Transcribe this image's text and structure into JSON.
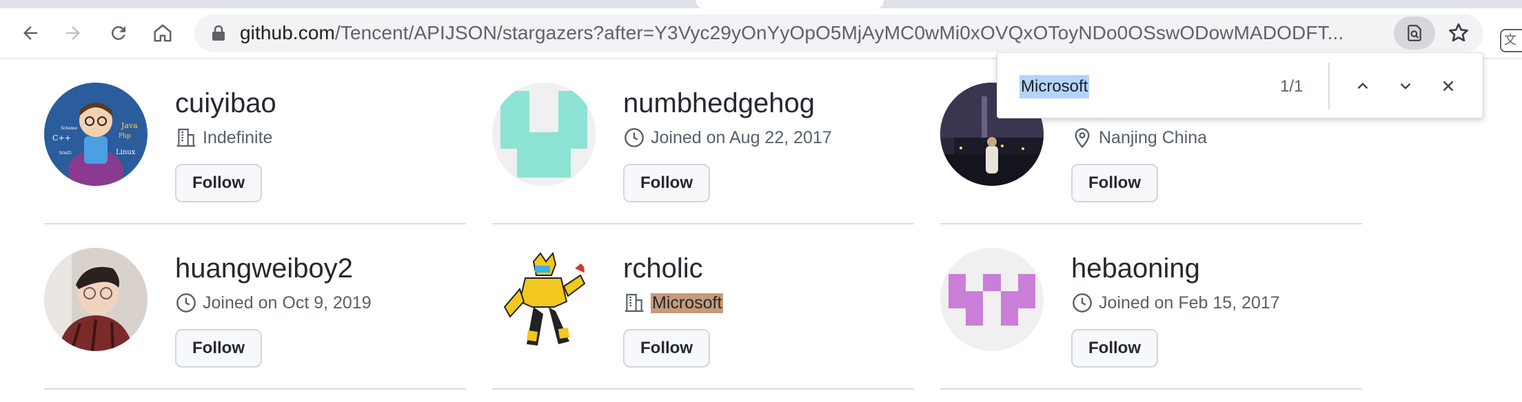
{
  "browser": {
    "url_host": "github.com",
    "url_path": "/Tencent/APIJSON/stargazers?after=Y3Vyc29yOnYyOpO5MjAyMC0wMi0xOVQxOToyNDo0OSswODowMADODFT...",
    "ext_glyph": "文"
  },
  "findbar": {
    "query": "Microsoft",
    "count": "1/1"
  },
  "users": [
    {
      "name": "cuiyibao",
      "meta_icon": "building-icon",
      "meta": "Indefinite",
      "highlight": false,
      "follow": "Follow"
    },
    {
      "name": "numbhedgehog",
      "meta_icon": "clock-icon",
      "meta": "Joined on Aug 22, 2017",
      "highlight": false,
      "follow": "Follow"
    },
    {
      "name": "",
      "meta_icon": "location-icon",
      "meta": "Nanjing China",
      "highlight": false,
      "follow": "Follow"
    },
    {
      "name": "huangweiboy2",
      "meta_icon": "clock-icon",
      "meta": "Joined on Oct 9, 2019",
      "highlight": false,
      "follow": "Follow"
    },
    {
      "name": "rcholic",
      "meta_icon": "building-icon",
      "meta": "Microsoft",
      "highlight": true,
      "follow": "Follow"
    },
    {
      "name": "hebaoning",
      "meta_icon": "clock-icon",
      "meta": "Joined on Feb 15, 2017",
      "highlight": false,
      "follow": "Follow"
    }
  ],
  "avatar_text": {
    "lang1": "Java",
    "lang2": "Php",
    "lang3": "C++",
    "lang4": "Linux",
    "lang5": "Scheme",
    "lang6": "html5"
  },
  "colors": {
    "identicon_teal": "#8de3d4",
    "identicon_purple": "#c97fd7",
    "find_highlight": "#b3d4fc",
    "match_highlight": "#c69b78"
  }
}
